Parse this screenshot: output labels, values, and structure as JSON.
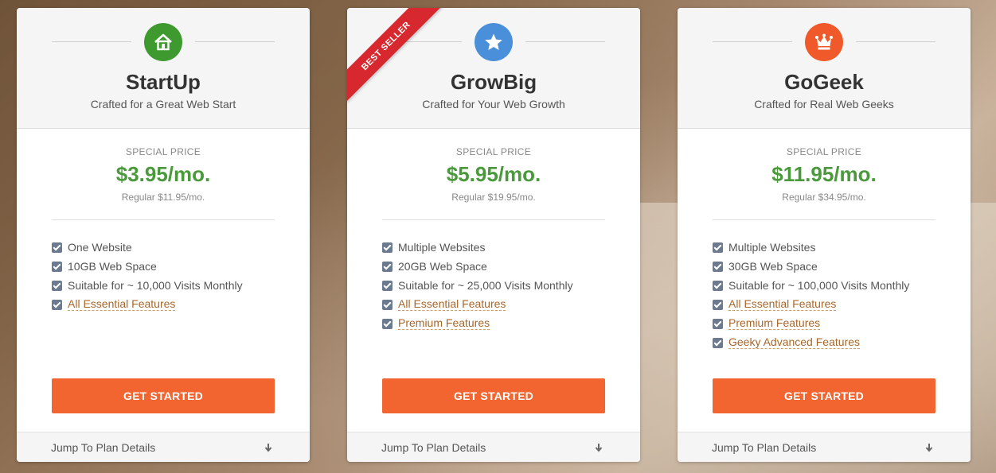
{
  "plans": [
    {
      "name": "StartUp",
      "tagline": "Crafted for a Great Web Start",
      "icon": "house-icon",
      "icon_color": "#3e9a2f",
      "special_label": "Special Price",
      "price": "$3.95/mo.",
      "regular": "Regular $11.95/mo.",
      "features": [
        {
          "text": "One Website",
          "link": false
        },
        {
          "text": "10GB Web Space",
          "link": false
        },
        {
          "text": "Suitable for ~ 10,000 Visits Monthly",
          "link": false
        },
        {
          "text": "All Essential Features",
          "link": true
        }
      ],
      "cta": "Get Started",
      "footer": "Jump To Plan Details"
    },
    {
      "name": "GrowBig",
      "tagline": "Crafted for Your Web Growth",
      "icon": "star-icon",
      "icon_color": "#4a8fd9",
      "ribbon": "BEST SELLER",
      "special_label": "Special Price",
      "price": "$5.95/mo.",
      "regular": "Regular $19.95/mo.",
      "features": [
        {
          "text": "Multiple Websites",
          "link": false
        },
        {
          "text": "20GB Web Space",
          "link": false
        },
        {
          "text": "Suitable for ~ 25,000 Visits Monthly",
          "link": false
        },
        {
          "text": "All Essential Features",
          "link": true
        },
        {
          "text": "Premium Features",
          "link": true
        }
      ],
      "cta": "Get Started",
      "footer": "Jump To Plan Details"
    },
    {
      "name": "GoGeek",
      "tagline": "Crafted for Real Web Geeks",
      "icon": "crown-icon",
      "icon_color": "#f05a2a",
      "special_label": "Special Price",
      "price": "$11.95/mo.",
      "regular": "Regular $34.95/mo.",
      "features": [
        {
          "text": "Multiple Websites",
          "link": false
        },
        {
          "text": "30GB Web Space",
          "link": false
        },
        {
          "text": "Suitable for ~ 100,000 Visits Monthly",
          "link": false
        },
        {
          "text": "All Essential Features",
          "link": true
        },
        {
          "text": "Premium Features",
          "link": true
        },
        {
          "text": "Geeky Advanced Features",
          "link": true
        }
      ],
      "cta": "Get Started",
      "footer": "Jump To Plan Details"
    }
  ],
  "colors": {
    "price_green": "#4a9a3c",
    "cta_orange": "#f26430",
    "ribbon_red": "#d7282f",
    "link_brown": "#a8672a"
  }
}
